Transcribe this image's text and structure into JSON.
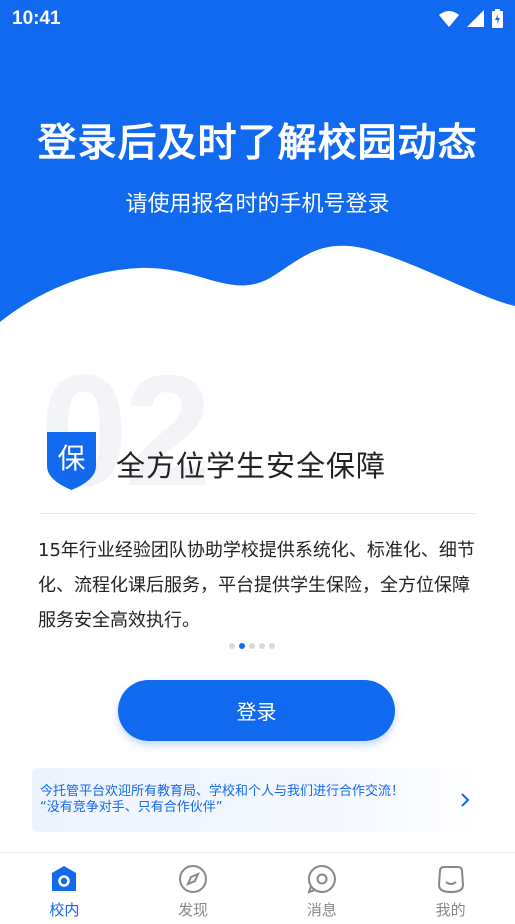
{
  "status": {
    "time": "10:41"
  },
  "hero": {
    "title": "登录后及时了解校园动态",
    "subtitle": "请使用报名时的手机号登录"
  },
  "feature": {
    "number": "02",
    "badge": "保",
    "title": "全方位学生安全保障",
    "description": "15年行业经验团队协助学校提供系统化、标准化、细节化、流程化课后服务，平台提供学生保险，全方位保障服务安全高效执行。"
  },
  "carousel": {
    "count": 5,
    "active_index": 1
  },
  "login_button": "登录",
  "notice": {
    "line1": "今托管平台欢迎所有教育局、学校和个人与我们进行合作交流！",
    "line2": "“没有竞争对手、只有合作伙伴”"
  },
  "tabs": [
    {
      "label": "校内",
      "icon": "school-home-icon",
      "active": true
    },
    {
      "label": "发现",
      "icon": "compass-icon",
      "active": false
    },
    {
      "label": "消息",
      "icon": "message-icon",
      "active": false
    },
    {
      "label": "我的",
      "icon": "profile-face-icon",
      "active": false
    }
  ],
  "colors": {
    "primary": "#1169ef",
    "text": "#222222",
    "muted": "#888888"
  }
}
